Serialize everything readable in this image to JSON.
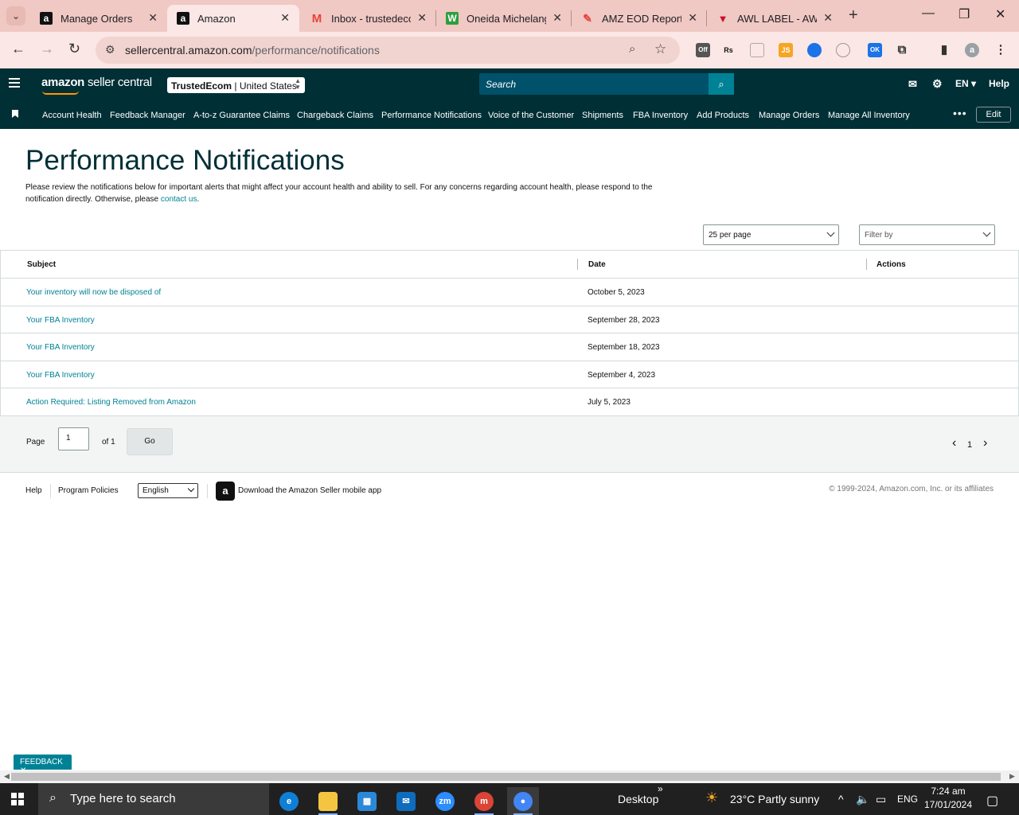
{
  "browser": {
    "tabs": [
      {
        "label": "Manage Orders",
        "favicon": "amazon-a",
        "active": false
      },
      {
        "label": "Amazon",
        "favicon": "amazon-a",
        "active": true
      },
      {
        "label": "Inbox - trustedeco",
        "favicon": "gmail",
        "active": false
      },
      {
        "label": "Oneida Michelang",
        "favicon": "w-green",
        "active": false
      },
      {
        "label": "AMZ EOD Report",
        "favicon": "pen-red",
        "active": false
      },
      {
        "label": "AWL LABEL - AWL",
        "favicon": "awl-red",
        "active": false
      }
    ],
    "url_domain": "sellercentral.amazon.com",
    "url_path": "/performance/notifications",
    "extensions": [
      {
        "name": "off-extension-icon",
        "text": "Off"
      },
      {
        "name": "rs-extension-icon",
        "text": "Rs"
      },
      {
        "name": "extension-icon-3",
        "text": ""
      },
      {
        "name": "js-extension-icon",
        "text": "JS"
      },
      {
        "name": "extension-icon-5",
        "text": ""
      },
      {
        "name": "extension-icon-6",
        "text": ""
      },
      {
        "name": "ok-extension-icon",
        "text": "OK"
      }
    ],
    "profile_initial": "a"
  },
  "header": {
    "logo_amazon": "amazon",
    "logo_rest": "seller central",
    "account_bold": "TrustedEcom",
    "account_rest": " | United States",
    "search_placeholder": "Search",
    "lang": "EN ▾",
    "help": "Help"
  },
  "nav": {
    "items": [
      "Account Health",
      "Feedback Manager",
      "A-to-z Guarantee Claims",
      "Chargeback Claims",
      "Performance Notifications",
      "Voice of the Customer",
      "Shipments",
      "FBA Inventory",
      "Add Products",
      "Manage Orders",
      "Manage All Inventory"
    ],
    "more": "•••",
    "edit": "Edit"
  },
  "page": {
    "title": "Performance Notifications",
    "intro": "Please review the notifications below for important alerts that might affect your account health and ability to sell. For any concerns regarding account health, please respond to the notification directly. Otherwise, please ",
    "intro_link": "contact us",
    "intro_end": ".",
    "per_page": "25 per page",
    "filter_placeholder": "Filter by"
  },
  "table": {
    "headers": {
      "subject": "Subject",
      "date": "Date",
      "actions": "Actions"
    },
    "rows": [
      {
        "subject": "Your inventory will now be disposed of",
        "date": "October 5, 2023"
      },
      {
        "subject": "Your FBA Inventory",
        "date": "September 28, 2023"
      },
      {
        "subject": "Your FBA Inventory",
        "date": "September 18, 2023"
      },
      {
        "subject": "Your FBA Inventory",
        "date": "September 4, 2023"
      },
      {
        "subject": "Action Required: Listing Removed from Amazon",
        "date": "July 5, 2023"
      }
    ]
  },
  "pager": {
    "page_label": "Page",
    "page_value": "1",
    "of_label": "of 1",
    "go": "Go",
    "current": "1",
    "prev": "‹",
    "next": "›"
  },
  "footer": {
    "help": "Help",
    "policies": "Program Policies",
    "language": "English",
    "app_text": "Download the Amazon Seller mobile app",
    "copyright": "© 1999-2024, Amazon.com, Inc. or its affiliates"
  },
  "feedback": "FEEDBACK ✕",
  "taskbar": {
    "search": "Type here to search",
    "desktop": "Desktop",
    "weather": "23°C  Partly sunny",
    "lang": "ENG",
    "time": "7:24 am",
    "date": "17/01/2024"
  },
  "colors": {
    "brand_dark": "#002f36",
    "link": "#008296",
    "accent": "#ff9900"
  }
}
